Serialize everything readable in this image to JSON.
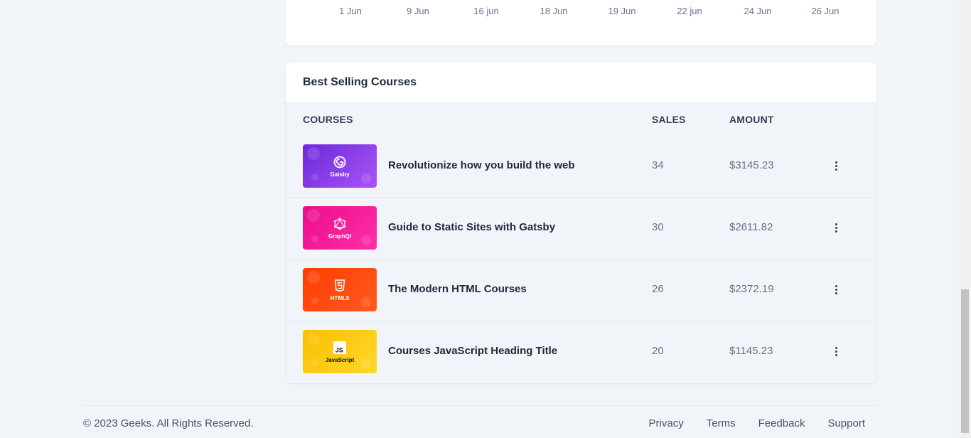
{
  "chart": {
    "x_labels": [
      "1 Jun",
      "9 Jun",
      "16 jun",
      "18 Jun",
      "19 Jun",
      "22 jun",
      "24 Jun",
      "26 Jun"
    ]
  },
  "courses_card": {
    "title": "Best Selling Courses",
    "columns": {
      "courses": "COURSES",
      "sales": "SALES",
      "amount": "AMOUNT"
    },
    "rows": [
      {
        "thumb_label": "Gatsby",
        "thumb_icon": "gatsby-icon",
        "thumb_color_start": "#6d28d9",
        "thumb_color_end": "#a855f7",
        "title": "Revolutionize how you build the web",
        "sales": "34",
        "amount": "$3145.23"
      },
      {
        "thumb_label": "GraphQl",
        "thumb_icon": "graphql-icon",
        "thumb_color_start": "#ec0c8c",
        "thumb_color_end": "#ff2fa8",
        "title": "Guide to Static Sites with Gatsby",
        "sales": "30",
        "amount": "$2611.82"
      },
      {
        "thumb_label": "HTML5",
        "thumb_icon": "html5-icon",
        "thumb_color_start": "#ff3d00",
        "thumb_color_end": "#ff5a1f",
        "title": "The Modern HTML Courses",
        "sales": "26",
        "amount": "$2372.19"
      },
      {
        "thumb_label": "JavaScript",
        "thumb_icon": "javascript-icon",
        "thumb_color_start": "#fbbf00",
        "thumb_color_end": "#ffd72a",
        "title": "Courses JavaScript Heading Title",
        "sales": "20",
        "amount": "$1145.23"
      }
    ]
  },
  "footer": {
    "copyright": "© 2023 Geeks. All Rights Reserved.",
    "links": [
      "Privacy",
      "Terms",
      "Feedback",
      "Support"
    ]
  }
}
